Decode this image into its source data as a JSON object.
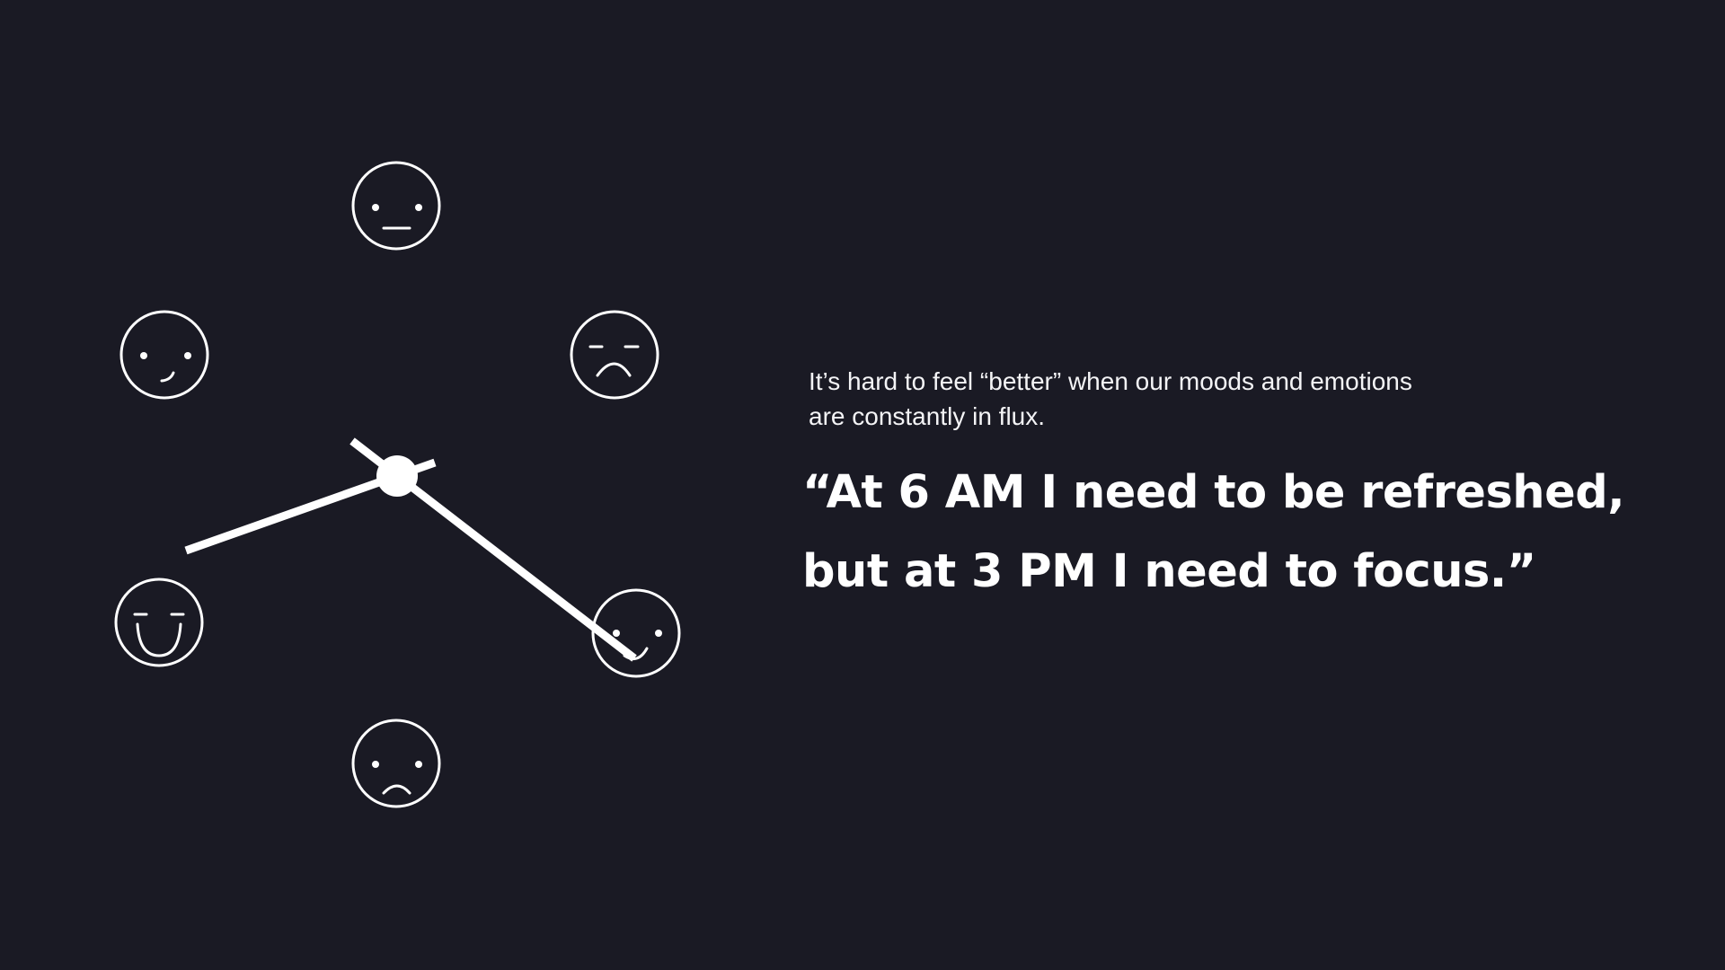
{
  "slide": {
    "background_color": "#1a1a24",
    "foreground_color": "#ffffff",
    "intro_line_1": "It’s hard to feel “better” when our moods and emotions",
    "intro_line_2": "are constantly in flux.",
    "quote_line_1": "“At 6 AM I need to be refreshed,",
    "quote_line_2": "but at 3 PM I need to focus.”"
  },
  "clock": {
    "faces": [
      {
        "position": "top",
        "expression": "neutral"
      },
      {
        "position": "upper-right",
        "expression": "sad-closed-eyes"
      },
      {
        "position": "right",
        "expression": "smirk"
      },
      {
        "position": "bottom",
        "expression": "frown"
      },
      {
        "position": "lower-left",
        "expression": "happy-closed-eyes"
      },
      {
        "position": "upper-left",
        "expression": "slight-smile"
      }
    ],
    "hands": [
      "hour-hand",
      "minute-hand"
    ]
  }
}
